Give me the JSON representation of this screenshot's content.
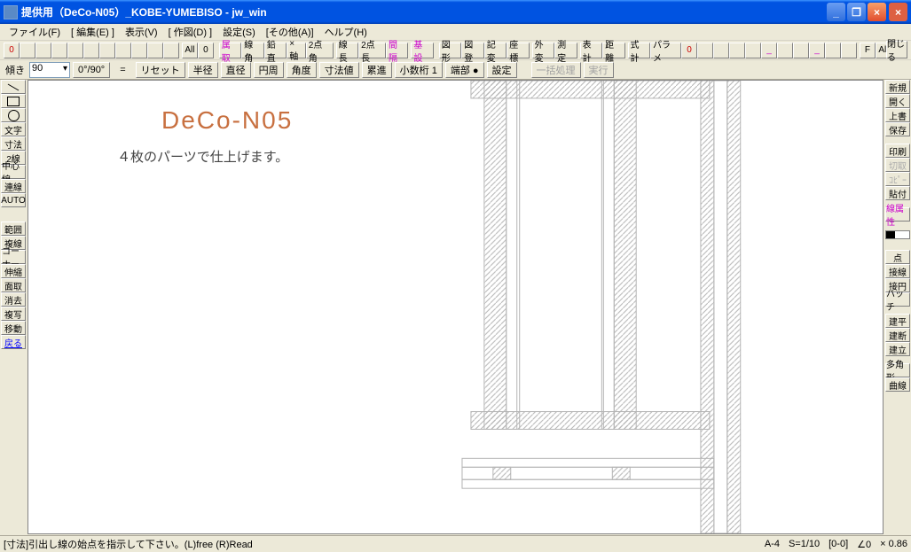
{
  "titlebar": {
    "text": "提供用（DeCo-N05）_KOBE-YUMEBISO - jw_win"
  },
  "menu": [
    "ファイル(F)",
    "[ 編集(E) ]",
    "表示(V)",
    "[ 作図(D) ]",
    "設定(S)",
    "[その他(A)]",
    "ヘルプ(H)"
  ],
  "tb1_left": [
    "0",
    "",
    "",
    "",
    "",
    "",
    "",
    "",
    "",
    "",
    ""
  ],
  "tb1_text": {
    "all": "All"
  },
  "tb1_main": [
    "属取",
    "線角",
    "鉛直",
    "×軸",
    "2点角",
    "線長",
    "2点長",
    "間隔",
    "基設",
    "",
    "図形",
    "図登",
    "記変",
    "座標",
    "",
    "外変",
    "測定",
    "",
    "表計",
    "距離",
    "",
    "式計",
    "パラメ"
  ],
  "tb1_right": [
    "0",
    "",
    "",
    "",
    "",
    "",
    "",
    "",
    "",
    "",
    "",
    "F",
    "All",
    "×"
  ],
  "tb2": {
    "slope_label": "傾き",
    "slope_value": "90",
    "angle_btn": "0°/90°",
    "eq": "=",
    "reset": "リセット",
    "hankei": "半径",
    "chokkei": "直径",
    "enshu": "円周",
    "kakudo": "角度",
    "sunpo": "寸法値",
    "ruishin": "累進",
    "shosu": "小数桁 1",
    "tanbu": "端部 ●",
    "settei": "設定",
    "ikkatsu": "一括処理",
    "jikko": "実行"
  },
  "left_tools": [
    "line",
    "rect",
    "circle",
    "文字",
    "寸法",
    "2線",
    "中心線",
    "連線",
    "AUTO",
    "",
    "範囲",
    "複線",
    "コーナー",
    "伸縮",
    "面取",
    "消去",
    "複写",
    "移動",
    "戻る"
  ],
  "right_tools": [
    "新規",
    "開く",
    "上書",
    "保存",
    "",
    "印刷",
    "切取",
    "ｺﾋﾟｰ",
    "貼付",
    "",
    "線属性",
    "",
    "",
    "点",
    "接線",
    "接円",
    "ハッチ",
    "",
    "建平",
    "建断",
    "建立",
    "",
    "多角形",
    "曲線"
  ],
  "canvas": {
    "title": "DeCo-N05",
    "subtitle": "４枚のパーツで仕上げます。"
  },
  "status": {
    "left": "[寸法]引出し線の始点を指示して下さい。(L)free  (R)Read",
    "r1": "A-4",
    "r2": "S=1/10",
    "r3": "[0-0]",
    "r4": "∠0",
    "r5": "× 0.86"
  }
}
